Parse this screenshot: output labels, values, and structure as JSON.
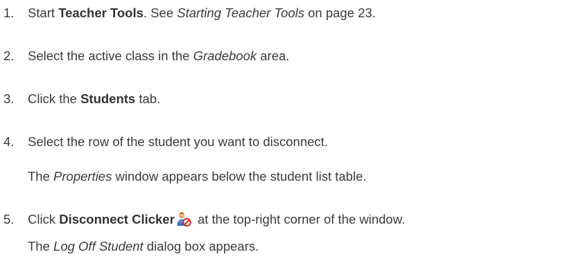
{
  "steps": [
    {
      "number": "1.",
      "parts": {
        "a": "Start ",
        "b": "Teacher Tools",
        "c": ". See ",
        "d": "Starting Teacher Tools",
        "e": " on page 23."
      }
    },
    {
      "number": "2.",
      "parts": {
        "a": "Select the active class in the ",
        "b": "Gradebook",
        "c": " area."
      }
    },
    {
      "number": "3.",
      "parts": {
        "a": "Click the ",
        "b": "Students",
        "c": " tab."
      }
    },
    {
      "number": "4.",
      "parts": {
        "a": "Select the row of the student you want to disconnect."
      },
      "note": {
        "a": "The ",
        "b": "Properties",
        "c": " window appears below the student list table."
      }
    },
    {
      "number": "5.",
      "parts": {
        "a": "Click ",
        "b": "Disconnect Clicker",
        "c": " at the top-right corner of the window."
      },
      "icon": "disconnect-clicker-icon",
      "note": {
        "a": "The ",
        "b": "Log Off Student",
        "c": " dialog box appears."
      }
    }
  ]
}
